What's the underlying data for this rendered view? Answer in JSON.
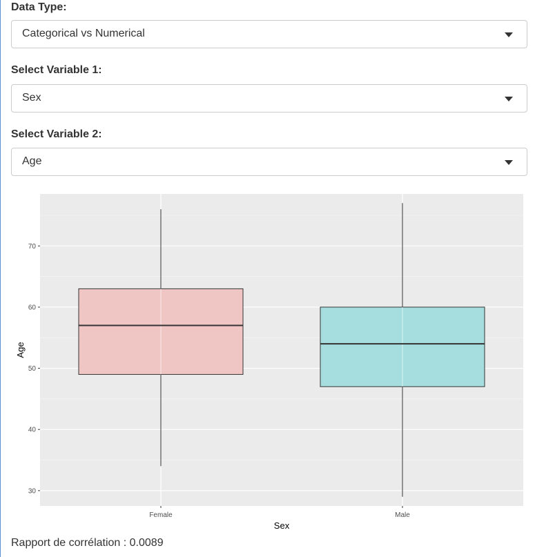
{
  "controls": {
    "data_type": {
      "label": "Data Type:",
      "selected": "Categorical vs Numerical"
    },
    "variable1": {
      "label": "Select Variable 1:",
      "selected": "Sex"
    },
    "variable2": {
      "label": "Select Variable 2:",
      "selected": "Age"
    }
  },
  "chart_data": {
    "type": "boxplot",
    "xlabel": "Sex",
    "ylabel": "Age",
    "ylim": [
      27.5,
      78.5
    ],
    "yticks": [
      30,
      40,
      50,
      60,
      70
    ],
    "grid": true,
    "categories": [
      "Female",
      "Male"
    ],
    "boxes": [
      {
        "category": "Female",
        "min": 34,
        "q1": 49,
        "median": 57,
        "q3": 63,
        "max": 76,
        "color": "#f0c6c4"
      },
      {
        "category": "Male",
        "min": 29,
        "q1": 47,
        "median": 54,
        "q3": 60,
        "max": 77,
        "color": "#a6dedf"
      }
    ]
  },
  "result": {
    "text": "Rapport de corrélation : 0.0089"
  }
}
